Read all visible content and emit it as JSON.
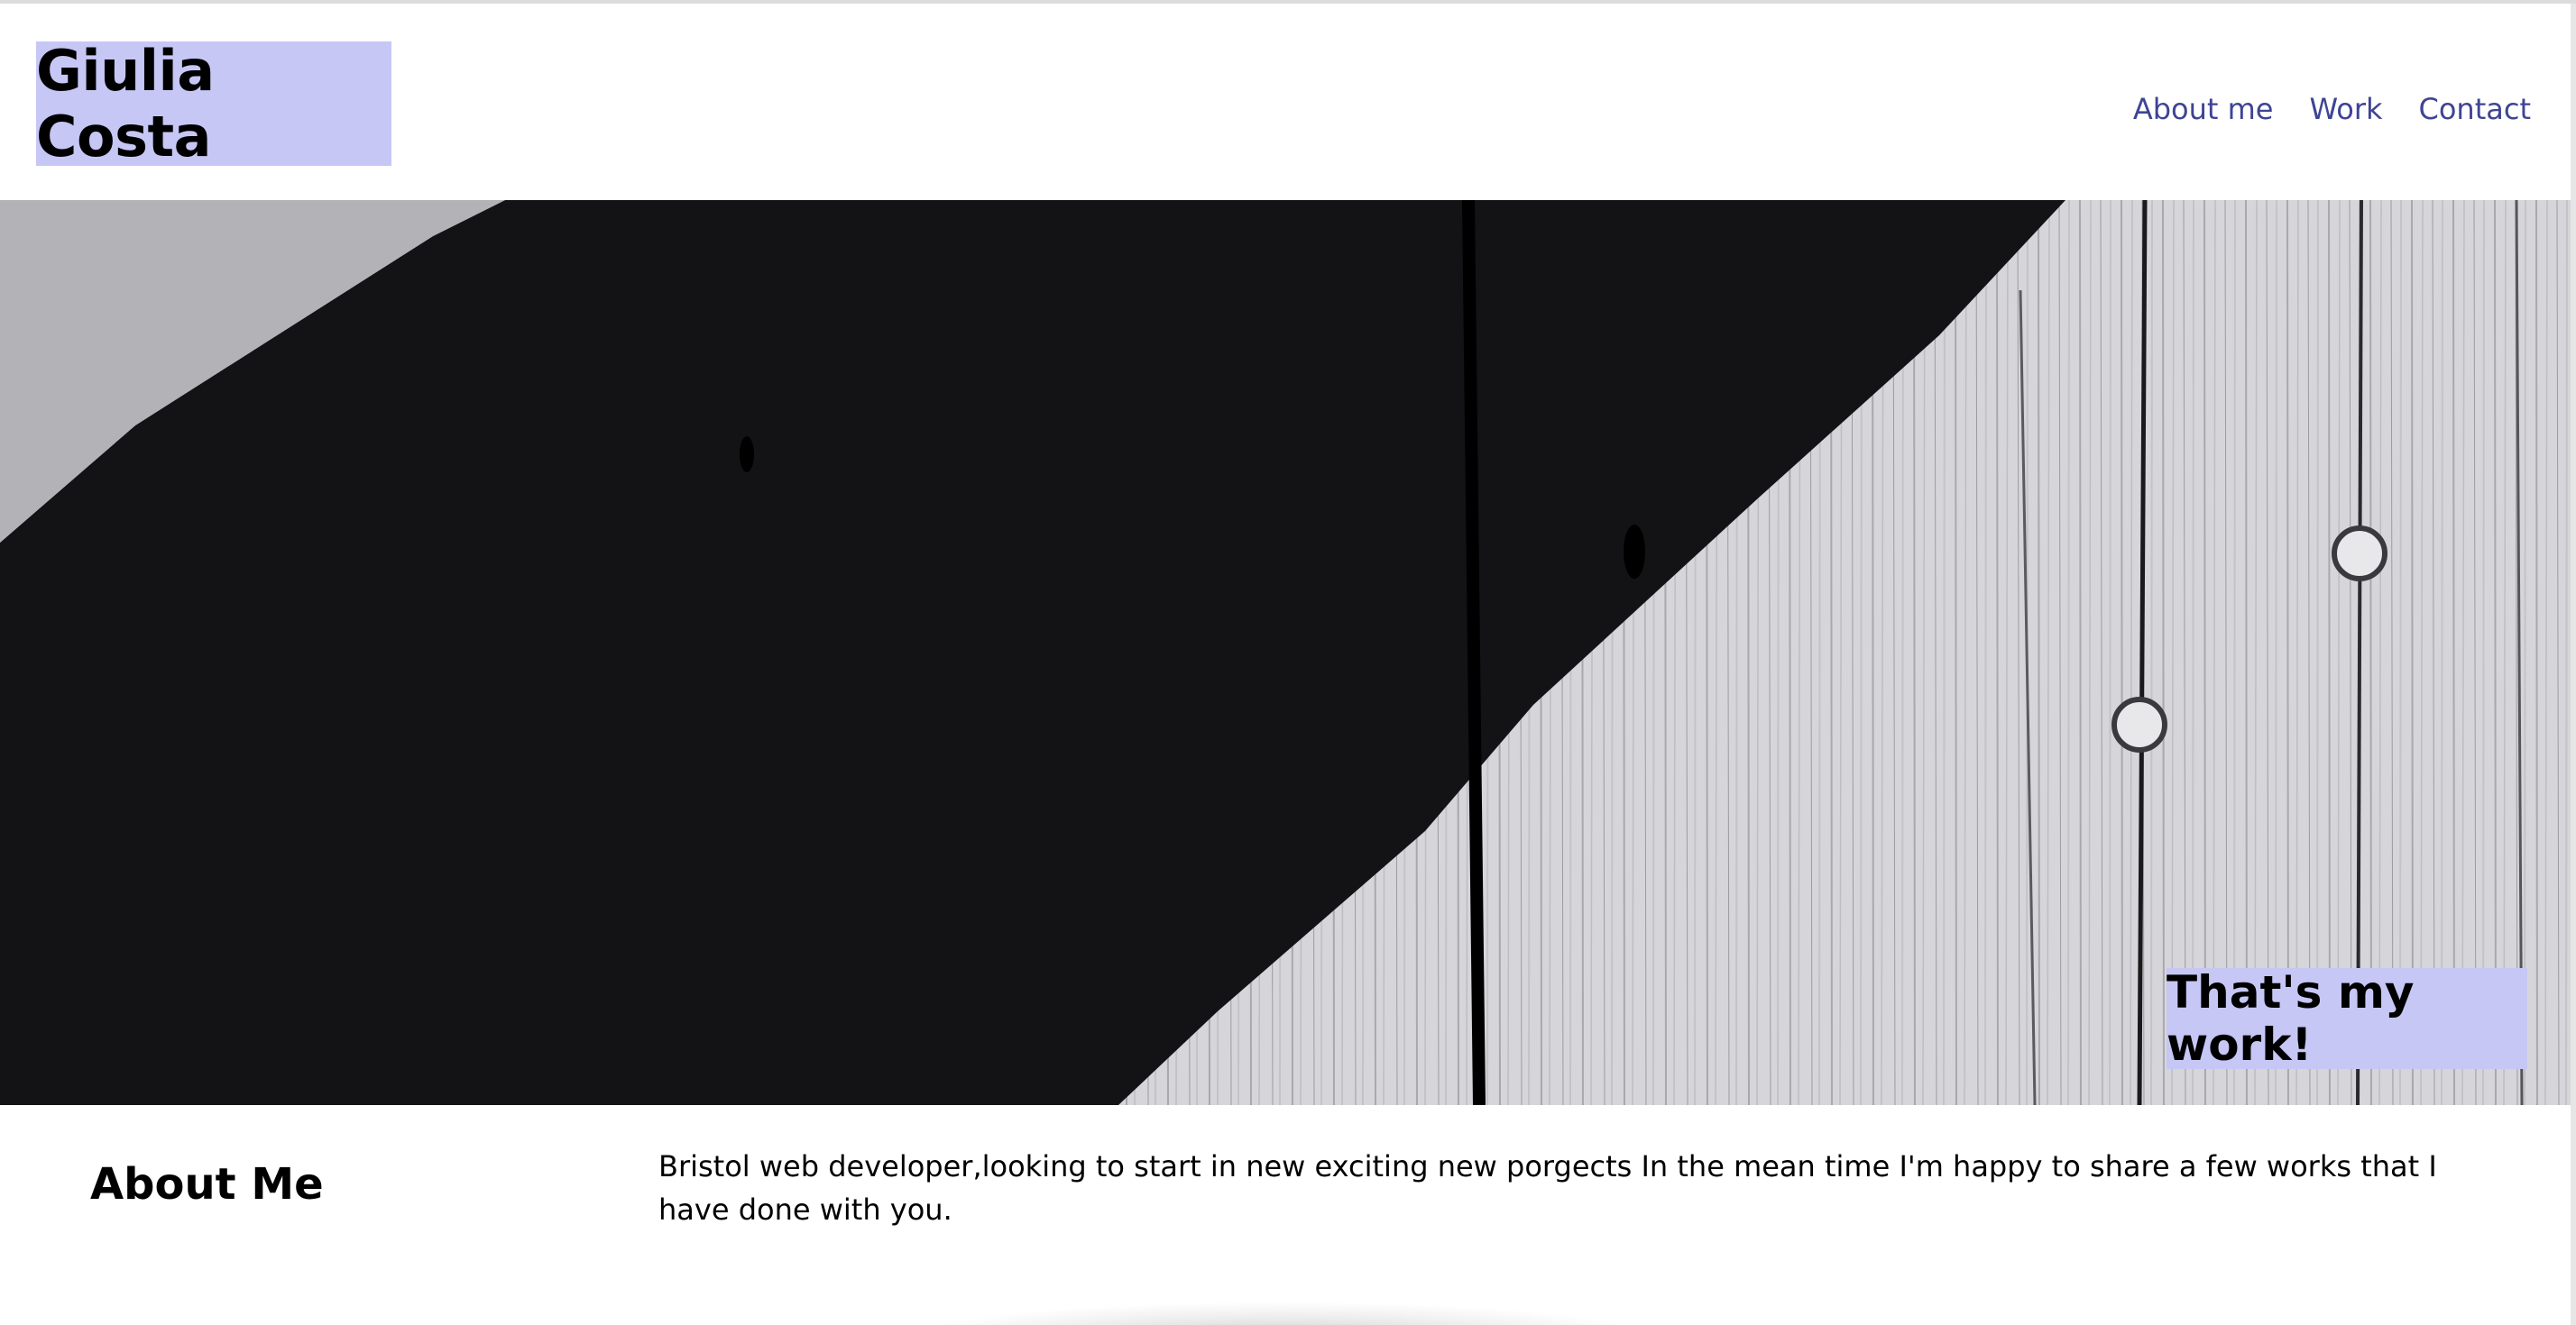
{
  "header": {
    "brand": "Giulia Costa",
    "nav": [
      {
        "label": "About me"
      },
      {
        "label": "Work"
      },
      {
        "label": "Contact"
      }
    ]
  },
  "hero": {
    "image_alt": "black and white painted wooden planks",
    "cta_label": "That's my work!"
  },
  "about": {
    "heading": "About Me",
    "body": "Bristol web developer,looking to start in new exciting new porgects In the mean time I'm happy to share a few works that I have done with you."
  },
  "colors": {
    "accent": "#c6c7f5",
    "nav_link": "#3f4494",
    "dark_paint": "#131315",
    "light_wood": "#d8d8dc"
  }
}
